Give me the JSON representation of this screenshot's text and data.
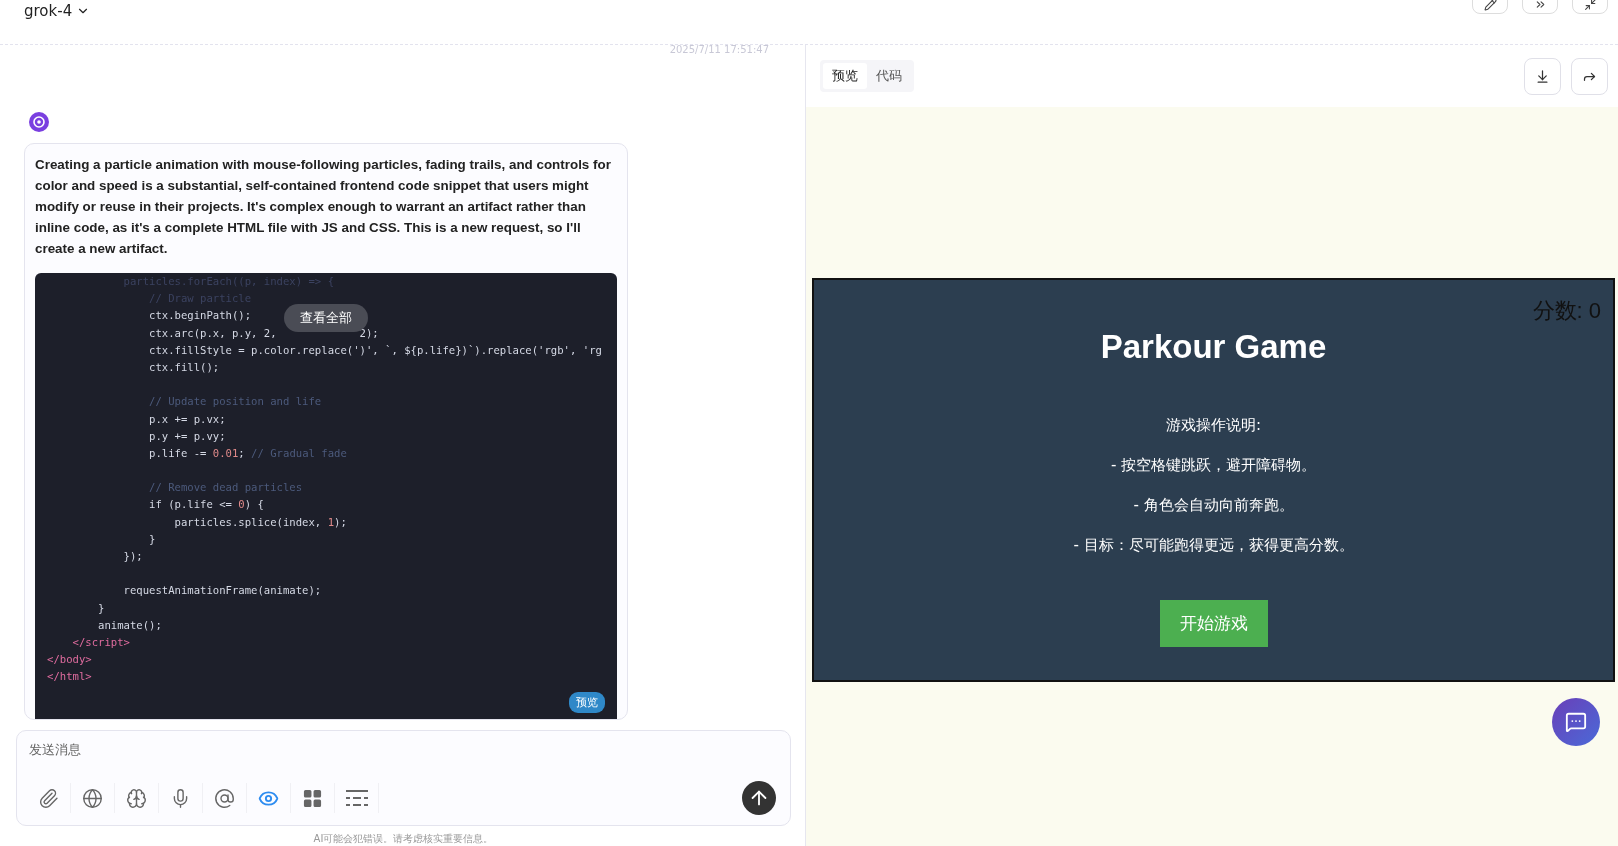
{
  "header": {
    "model": "grok-4"
  },
  "chat": {
    "timestamp": "2025/7/11 17:51:47",
    "message": "Creating a particle animation with mouse-following particles, fading trails, and controls for color and speed is a substantial, self-contained frontend code snippet that users might modify or reuse in their projects. It's complex enough to warrant an artifact rather than inline code, as it's a complete HTML file with JS and CSS. This is a new request, so I'll create a new artifact.",
    "code": {
      "view_all": "查看全部",
      "preview_badge": "预览",
      "lines": [
        {
          "kind": "code",
          "segments": [
            {
              "text": "            particles.forEach((p, index) => {",
              "kind": "faded"
            }
          ]
        },
        {
          "kind": "code",
          "segments": [
            {
              "text": "                // Draw particle",
              "kind": "faded"
            }
          ]
        },
        {
          "kind": "code",
          "segments": [
            {
              "text": "                ctx.beginPath();",
              "kind": "plain"
            }
          ]
        },
        {
          "kind": "gap",
          "segments": [
            {
              "text": "                ctx.arc(p.x, p.y, 2,",
              "kind": "plain"
            },
            {
              "text": "2);",
              "kind": "plain"
            }
          ]
        },
        {
          "kind": "code",
          "segments": [
            {
              "text": "                ctx.fillStyle = p.color.replace(')', `, ${p.life})`).replace('rgb', 'rg",
              "kind": "plain"
            }
          ]
        },
        {
          "kind": "code",
          "segments": [
            {
              "text": "                ctx.fill();",
              "kind": "plain"
            }
          ]
        },
        {
          "kind": "blank"
        },
        {
          "kind": "code",
          "segments": [
            {
              "text": "                // Update position and life",
              "kind": "comment"
            }
          ]
        },
        {
          "kind": "code",
          "segments": [
            {
              "text": "                p.x += p.vx;",
              "kind": "plain"
            }
          ]
        },
        {
          "kind": "code",
          "segments": [
            {
              "text": "                p.y += p.vy;",
              "kind": "plain"
            }
          ]
        },
        {
          "kind": "code",
          "segments": [
            {
              "text": "                p.life -= ",
              "kind": "plain"
            },
            {
              "text": "0.01",
              "kind": "number"
            },
            {
              "text": "; ",
              "kind": "plain"
            },
            {
              "text": "// Gradual fade",
              "kind": "comment"
            }
          ]
        },
        {
          "kind": "blank"
        },
        {
          "kind": "code",
          "segments": [
            {
              "text": "                // Remove dead particles",
              "kind": "comment"
            }
          ]
        },
        {
          "kind": "code",
          "segments": [
            {
              "text": "                if (p.life <= ",
              "kind": "plain"
            },
            {
              "text": "0",
              "kind": "number"
            },
            {
              "text": ") {",
              "kind": "plain"
            }
          ]
        },
        {
          "kind": "code",
          "segments": [
            {
              "text": "                    particles.splice(index, ",
              "kind": "plain"
            },
            {
              "text": "1",
              "kind": "number"
            },
            {
              "text": ");",
              "kind": "plain"
            }
          ]
        },
        {
          "kind": "code",
          "segments": [
            {
              "text": "                }",
              "kind": "plain"
            }
          ]
        },
        {
          "kind": "code",
          "segments": [
            {
              "text": "            });",
              "kind": "plain"
            }
          ]
        },
        {
          "kind": "blank"
        },
        {
          "kind": "code",
          "segments": [
            {
              "text": "            requestAnimationFrame(animate);",
              "kind": "plain"
            }
          ]
        },
        {
          "kind": "code",
          "segments": [
            {
              "text": "        }",
              "kind": "plain"
            }
          ]
        },
        {
          "kind": "code",
          "segments": [
            {
              "text": "        animate();",
              "kind": "plain"
            }
          ]
        },
        {
          "kind": "code",
          "segments": [
            {
              "text": "    </script>",
              "kind": "tag"
            }
          ]
        },
        {
          "kind": "code",
          "segments": [
            {
              "text": "</body>",
              "kind": "tag"
            }
          ]
        },
        {
          "kind": "code",
          "segments": [
            {
              "text": "</html>",
              "kind": "tag"
            }
          ]
        }
      ]
    }
  },
  "composer": {
    "placeholder": "发送消息",
    "tools": [
      {
        "kind": "attach",
        "selected": false
      },
      {
        "kind": "web",
        "selected": false
      },
      {
        "kind": "think",
        "selected": false
      },
      {
        "kind": "voice",
        "selected": false
      },
      {
        "kind": "mention",
        "selected": false
      },
      {
        "kind": "view",
        "selected": true
      },
      {
        "kind": "apps",
        "selected": false
      },
      {
        "kind": "lines",
        "selected": false
      }
    ],
    "disclaimer": "AI可能会犯错误。请考虑核实重要信息。"
  },
  "preview": {
    "tabs": [
      {
        "label": "预览",
        "selected": true
      },
      {
        "label": "代码",
        "selected": false
      }
    ],
    "game": {
      "score": "分数: 0",
      "title": "Parkour Game",
      "heading": "游戏操作说明:",
      "instructions": [
        "- 按空格键跳跃，避开障碍物。",
        "- 角色会自动向前奔跑。",
        "- 目标：尽可能跑得更远，获得更高分数。"
      ],
      "start": "开始游戏"
    }
  }
}
